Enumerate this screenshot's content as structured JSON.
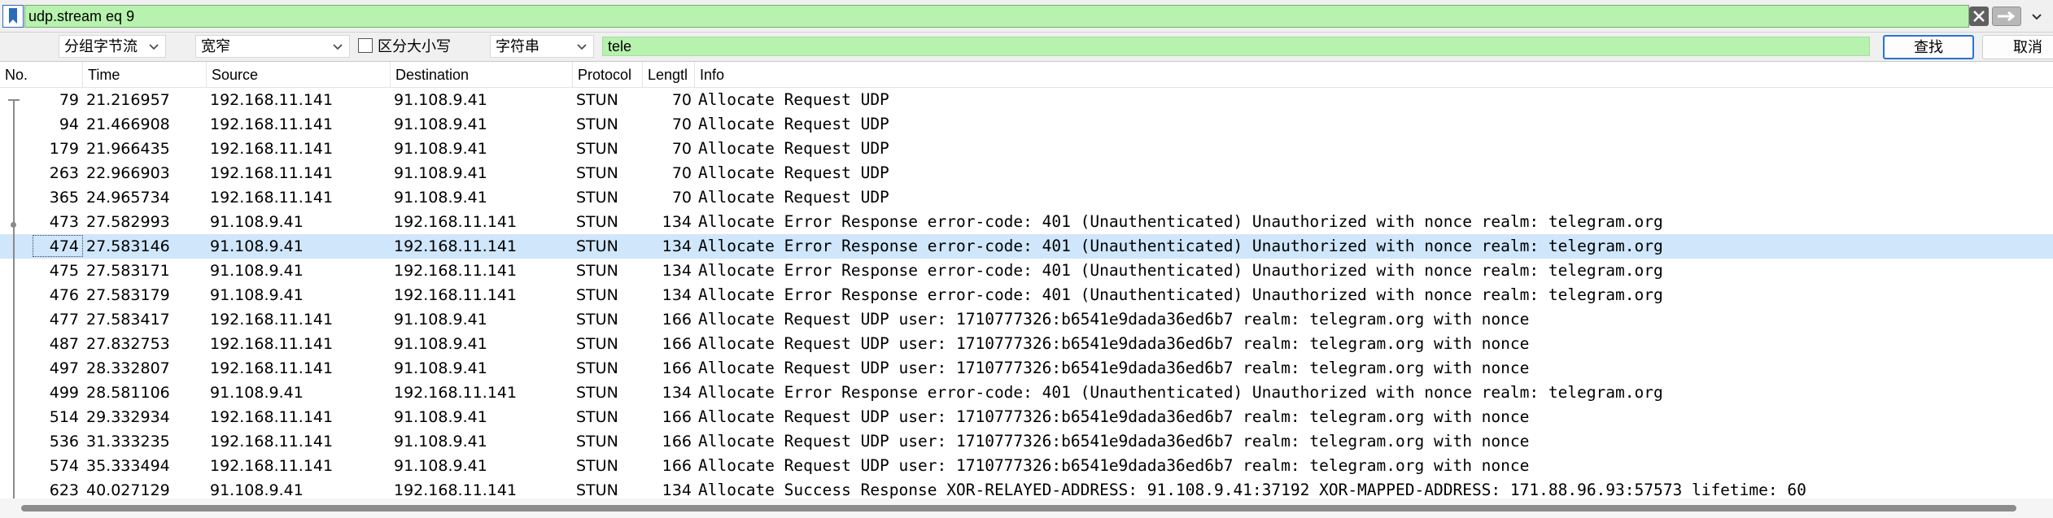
{
  "filter": {
    "value": "udp.stream eq 9",
    "icons": [
      "bookmark-icon",
      "clear-icon",
      "apply-arrow-icon",
      "chevron-down-icon"
    ]
  },
  "find_bar": {
    "direction_combo": "分组字节流",
    "width_combo": "宽窄",
    "case_sensitive_label": "区分大小写",
    "case_sensitive_checked": false,
    "type_combo": "字符串",
    "search_value": "tele",
    "find_button": "查找",
    "cancel_button": "取消"
  },
  "columns": {
    "no": "No.",
    "time": "Time",
    "source": "Source",
    "destination": "Destination",
    "protocol": "Protocol",
    "length": "Lengtl",
    "info": "Info"
  },
  "rows": [
    {
      "no": "79",
      "time": "21.216957",
      "source": "192.168.11.141",
      "destination": "91.108.9.41",
      "protocol": "STUN",
      "length": "70",
      "info": "Allocate Request UDP"
    },
    {
      "no": "94",
      "time": "21.466908",
      "source": "192.168.11.141",
      "destination": "91.108.9.41",
      "protocol": "STUN",
      "length": "70",
      "info": "Allocate Request UDP"
    },
    {
      "no": "179",
      "time": "21.966435",
      "source": "192.168.11.141",
      "destination": "91.108.9.41",
      "protocol": "STUN",
      "length": "70",
      "info": "Allocate Request UDP"
    },
    {
      "no": "263",
      "time": "22.966903",
      "source": "192.168.11.141",
      "destination": "91.108.9.41",
      "protocol": "STUN",
      "length": "70",
      "info": "Allocate Request UDP"
    },
    {
      "no": "365",
      "time": "24.965734",
      "source": "192.168.11.141",
      "destination": "91.108.9.41",
      "protocol": "STUN",
      "length": "70",
      "info": "Allocate Request UDP"
    },
    {
      "no": "473",
      "time": "27.582993",
      "source": "91.108.9.41",
      "destination": "192.168.11.141",
      "protocol": "STUN",
      "length": "134",
      "info": "Allocate Error Response error-code: 401 (Unauthenticated) Unauthorized with nonce realm: telegram.org"
    },
    {
      "no": "474",
      "time": "27.583146",
      "source": "91.108.9.41",
      "destination": "192.168.11.141",
      "protocol": "STUN",
      "length": "134",
      "info": "Allocate Error Response error-code: 401 (Unauthenticated) Unauthorized with nonce realm: telegram.org"
    },
    {
      "no": "475",
      "time": "27.583171",
      "source": "91.108.9.41",
      "destination": "192.168.11.141",
      "protocol": "STUN",
      "length": "134",
      "info": "Allocate Error Response error-code: 401 (Unauthenticated) Unauthorized with nonce realm: telegram.org"
    },
    {
      "no": "476",
      "time": "27.583179",
      "source": "91.108.9.41",
      "destination": "192.168.11.141",
      "protocol": "STUN",
      "length": "134",
      "info": "Allocate Error Response error-code: 401 (Unauthenticated) Unauthorized with nonce realm: telegram.org"
    },
    {
      "no": "477",
      "time": "27.583417",
      "source": "192.168.11.141",
      "destination": "91.108.9.41",
      "protocol": "STUN",
      "length": "166",
      "info": "Allocate Request UDP user: 1710777326:b6541e9dada36ed6b7 realm: telegram.org with nonce"
    },
    {
      "no": "487",
      "time": "27.832753",
      "source": "192.168.11.141",
      "destination": "91.108.9.41",
      "protocol": "STUN",
      "length": "166",
      "info": "Allocate Request UDP user: 1710777326:b6541e9dada36ed6b7 realm: telegram.org with nonce"
    },
    {
      "no": "497",
      "time": "28.332807",
      "source": "192.168.11.141",
      "destination": "91.108.9.41",
      "protocol": "STUN",
      "length": "166",
      "info": "Allocate Request UDP user: 1710777326:b6541e9dada36ed6b7 realm: telegram.org with nonce"
    },
    {
      "no": "499",
      "time": "28.581106",
      "source": "91.108.9.41",
      "destination": "192.168.11.141",
      "protocol": "STUN",
      "length": "134",
      "info": "Allocate Error Response error-code: 401 (Unauthenticated) Unauthorized with nonce realm: telegram.org"
    },
    {
      "no": "514",
      "time": "29.332934",
      "source": "192.168.11.141",
      "destination": "91.108.9.41",
      "protocol": "STUN",
      "length": "166",
      "info": "Allocate Request UDP user: 1710777326:b6541e9dada36ed6b7 realm: telegram.org with nonce"
    },
    {
      "no": "536",
      "time": "31.333235",
      "source": "192.168.11.141",
      "destination": "91.108.9.41",
      "protocol": "STUN",
      "length": "166",
      "info": "Allocate Request UDP user: 1710777326:b6541e9dada36ed6b7 realm: telegram.org with nonce"
    },
    {
      "no": "574",
      "time": "35.333494",
      "source": "192.168.11.141",
      "destination": "91.108.9.41",
      "protocol": "STUN",
      "length": "166",
      "info": "Allocate Request UDP user: 1710777326:b6541e9dada36ed6b7 realm: telegram.org with nonce"
    },
    {
      "no": "623",
      "time": "40.027129",
      "source": "91.108.9.41",
      "destination": "192.168.11.141",
      "protocol": "STUN",
      "length": "134",
      "info": "Allocate Success Response XOR-RELAYED-ADDRESS: 91.108.9.41:37192 XOR-MAPPED-ADDRESS: 171.88.96.93:57573 lifetime: 60"
    }
  ],
  "selected_row_no": "474",
  "colors": {
    "filter_bg": "#b7f2ae",
    "selected_row_bg": "#cfe6fb",
    "button_focus": "#2a72d6"
  }
}
